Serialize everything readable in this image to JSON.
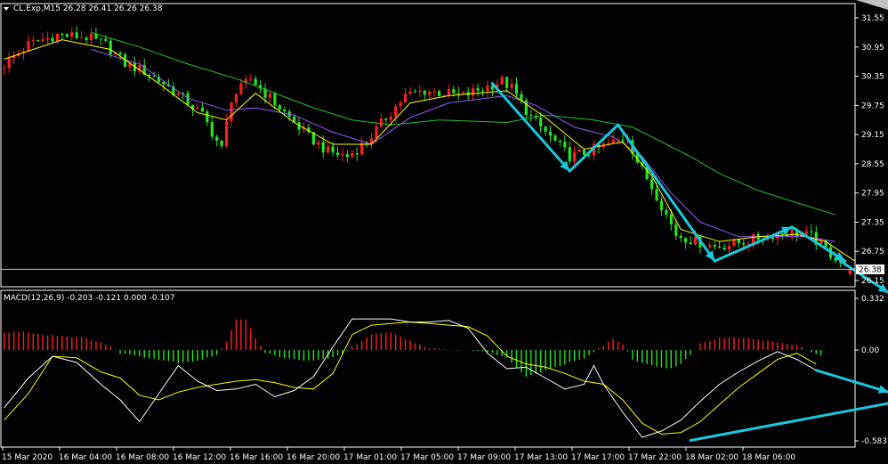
{
  "window": {
    "title": "CL.Exp,M15  26.28 26.41 26.26 26.38",
    "dropdown_icon": "triangle-down-icon",
    "close_icon": "corner-triangle-icon"
  },
  "colors": {
    "background": "#000000",
    "axis": "#ffffff",
    "bull": "#ff1e1e",
    "bear": "#22e622",
    "ma_fast": "#ffff00",
    "ma_mid": "#9b59ff",
    "ma_slow": "#27c427",
    "arrow": "#19c8dc",
    "macd_line": "#ffffff",
    "signal_line": "#ffff00"
  },
  "price_axis": {
    "min": 26.15,
    "max": 31.55,
    "ticks": [
      "31.55",
      "30.95",
      "30.35",
      "29.75",
      "29.15",
      "28.55",
      "27.95",
      "27.35",
      "26.75",
      "26.15"
    ],
    "current_label": "26.38",
    "current_value": 26.38
  },
  "macd_axis": {
    "min": -0.583,
    "max": 0.332,
    "ticks": [
      "0.332",
      "0.00",
      "-0.583"
    ]
  },
  "macd_panel": {
    "title": "MACD(12,26,9) -0.203 -0.121 0.000 -0.107"
  },
  "time_axis": {
    "labels": [
      "15 Mar 2020",
      "16 Mar 04:00",
      "16 Mar 08:00",
      "16 Mar 12:00",
      "16 Mar 16:00",
      "16 Mar 20:00",
      "17 Mar 01:00",
      "17 Mar 05:00",
      "17 Mar 09:00",
      "17 Mar 13:00",
      "17 Mar 17:00",
      "17 Mar 22:00",
      "18 Mar 02:00",
      "18 Mar 06:00"
    ]
  },
  "chart_data": {
    "type": "candlestick",
    "symbol": "CL.Exp",
    "timeframe": "M15",
    "last_bar": {
      "open": 26.28,
      "high": 26.41,
      "low": 26.26,
      "close": 26.38
    },
    "price_path": [
      [
        0,
        30.5
      ],
      [
        6,
        31.0
      ],
      [
        12,
        31.2
      ],
      [
        18,
        31.15
      ],
      [
        22,
        31.0
      ],
      [
        26,
        30.6
      ],
      [
        30,
        30.45
      ],
      [
        34,
        30.2
      ],
      [
        38,
        29.9
      ],
      [
        42,
        29.55
      ],
      [
        46,
        28.85
      ],
      [
        48,
        29.9
      ],
      [
        52,
        30.3
      ],
      [
        56,
        29.9
      ],
      [
        60,
        29.5
      ],
      [
        64,
        29.1
      ],
      [
        68,
        28.8
      ],
      [
        72,
        28.7
      ],
      [
        76,
        29.0
      ],
      [
        80,
        29.5
      ],
      [
        84,
        29.95
      ],
      [
        88,
        30.05
      ],
      [
        92,
        30.0
      ],
      [
        96,
        29.95
      ],
      [
        100,
        30.1
      ],
      [
        104,
        30.25
      ],
      [
        106,
        30.1
      ],
      [
        110,
        29.5
      ],
      [
        114,
        29.1
      ],
      [
        118,
        28.7
      ],
      [
        122,
        28.8
      ],
      [
        126,
        28.95
      ],
      [
        130,
        29.1
      ],
      [
        132,
        28.6
      ],
      [
        136,
        27.9
      ],
      [
        140,
        27.1
      ],
      [
        144,
        26.95
      ],
      [
        148,
        26.85
      ],
      [
        152,
        26.9
      ],
      [
        156,
        27.0
      ],
      [
        160,
        27.1
      ],
      [
        164,
        27.15
      ],
      [
        168,
        27.05
      ],
      [
        172,
        26.7
      ],
      [
        176,
        26.38
      ]
    ],
    "histogram": [
      [
        0,
        0.11
      ],
      [
        4,
        0.12
      ],
      [
        8,
        0.1
      ],
      [
        12,
        0.09
      ],
      [
        16,
        0.08
      ],
      [
        20,
        0.05
      ],
      [
        22,
        0.02
      ],
      [
        24,
        -0.02
      ],
      [
        28,
        -0.04
      ],
      [
        32,
        -0.06
      ],
      [
        36,
        -0.08
      ],
      [
        40,
        -0.07
      ],
      [
        44,
        -0.03
      ],
      [
        46,
        0.05
      ],
      [
        48,
        0.2
      ],
      [
        50,
        0.2
      ],
      [
        52,
        0.08
      ],
      [
        54,
        -0.02
      ],
      [
        58,
        -0.05
      ],
      [
        62,
        -0.07
      ],
      [
        66,
        -0.06
      ],
      [
        70,
        -0.03
      ],
      [
        72,
        0.02
      ],
      [
        76,
        0.1
      ],
      [
        80,
        0.11
      ],
      [
        84,
        0.06
      ],
      [
        88,
        0.01
      ],
      [
        92,
        0.0
      ],
      [
        96,
        0.0
      ],
      [
        100,
        -0.01
      ],
      [
        104,
        -0.05
      ],
      [
        106,
        -0.11
      ],
      [
        108,
        -0.17
      ],
      [
        112,
        -0.13
      ],
      [
        116,
        -0.09
      ],
      [
        120,
        -0.05
      ],
      [
        124,
        0.03
      ],
      [
        126,
        0.07
      ],
      [
        128,
        0.04
      ],
      [
        130,
        -0.06
      ],
      [
        134,
        -0.1
      ],
      [
        138,
        -0.12
      ],
      [
        140,
        -0.09
      ],
      [
        142,
        -0.03
      ],
      [
        144,
        0.04
      ],
      [
        148,
        0.08
      ],
      [
        152,
        0.08
      ],
      [
        156,
        0.07
      ],
      [
        160,
        0.05
      ],
      [
        164,
        0.03
      ],
      [
        168,
        -0.03
      ],
      [
        172,
        -0.05
      ]
    ],
    "macd_line": [
      [
        0,
        -0.37
      ],
      [
        5,
        -0.18
      ],
      [
        10,
        -0.04
      ],
      [
        15,
        -0.08
      ],
      [
        20,
        -0.22
      ],
      [
        24,
        -0.32
      ],
      [
        28,
        -0.46
      ],
      [
        32,
        -0.28
      ],
      [
        36,
        -0.1
      ],
      [
        40,
        -0.2
      ],
      [
        44,
        -0.26
      ],
      [
        48,
        -0.25
      ],
      [
        52,
        -0.22
      ],
      [
        56,
        -0.3
      ],
      [
        60,
        -0.26
      ],
      [
        64,
        -0.17
      ],
      [
        68,
        0.02
      ],
      [
        72,
        0.2
      ],
      [
        76,
        0.2
      ],
      [
        80,
        0.2
      ],
      [
        84,
        0.18
      ],
      [
        88,
        0.18
      ],
      [
        92,
        0.19
      ],
      [
        96,
        0.14
      ],
      [
        100,
        -0.02
      ],
      [
        104,
        -0.12
      ],
      [
        108,
        -0.11
      ],
      [
        112,
        -0.18
      ],
      [
        116,
        -0.25
      ],
      [
        120,
        -0.22
      ],
      [
        122,
        -0.1
      ],
      [
        124,
        -0.22
      ],
      [
        128,
        -0.4
      ],
      [
        132,
        -0.56
      ],
      [
        136,
        -0.52
      ],
      [
        140,
        -0.45
      ],
      [
        144,
        -0.33
      ],
      [
        148,
        -0.22
      ],
      [
        152,
        -0.14
      ],
      [
        156,
        -0.07
      ],
      [
        160,
        -0.01
      ],
      [
        164,
        -0.06
      ],
      [
        168,
        -0.13
      ]
    ],
    "signal_line": [
      [
        0,
        -0.45
      ],
      [
        5,
        -0.28
      ],
      [
        10,
        -0.04
      ],
      [
        15,
        -0.05
      ],
      [
        20,
        -0.14
      ],
      [
        24,
        -0.18
      ],
      [
        28,
        -0.29
      ],
      [
        32,
        -0.32
      ],
      [
        36,
        -0.27
      ],
      [
        40,
        -0.24
      ],
      [
        44,
        -0.22
      ],
      [
        48,
        -0.2
      ],
      [
        52,
        -0.19
      ],
      [
        56,
        -0.21
      ],
      [
        60,
        -0.24
      ],
      [
        64,
        -0.25
      ],
      [
        68,
        -0.15
      ],
      [
        72,
        0.1
      ],
      [
        76,
        0.16
      ],
      [
        80,
        0.17
      ],
      [
        84,
        0.18
      ],
      [
        88,
        0.17
      ],
      [
        92,
        0.16
      ],
      [
        96,
        0.15
      ],
      [
        100,
        0.09
      ],
      [
        104,
        -0.04
      ],
      [
        108,
        -0.09
      ],
      [
        112,
        -0.11
      ],
      [
        116,
        -0.15
      ],
      [
        120,
        -0.2
      ],
      [
        124,
        -0.22
      ],
      [
        128,
        -0.32
      ],
      [
        132,
        -0.47
      ],
      [
        136,
        -0.54
      ],
      [
        140,
        -0.53
      ],
      [
        144,
        -0.46
      ],
      [
        148,
        -0.35
      ],
      [
        152,
        -0.24
      ],
      [
        156,
        -0.15
      ],
      [
        160,
        -0.06
      ],
      [
        164,
        -0.02
      ],
      [
        168,
        -0.09
      ]
    ],
    "ma_fast": [
      [
        0,
        30.7
      ],
      [
        12,
        31.1
      ],
      [
        22,
        30.9
      ],
      [
        32,
        30.2
      ],
      [
        40,
        29.6
      ],
      [
        46,
        29.45
      ],
      [
        52,
        30.0
      ],
      [
        60,
        29.4
      ],
      [
        68,
        28.95
      ],
      [
        76,
        28.95
      ],
      [
        84,
        29.8
      ],
      [
        92,
        29.95
      ],
      [
        104,
        30.05
      ],
      [
        112,
        29.5
      ],
      [
        120,
        28.85
      ],
      [
        128,
        29.0
      ],
      [
        134,
        28.3
      ],
      [
        140,
        27.2
      ],
      [
        148,
        26.95
      ],
      [
        156,
        27.05
      ],
      [
        164,
        27.1
      ],
      [
        170,
        26.95
      ],
      [
        176,
        26.55
      ]
    ],
    "ma_mid": [
      [
        18,
        30.9
      ],
      [
        28,
        30.6
      ],
      [
        38,
        29.9
      ],
      [
        46,
        29.65
      ],
      [
        52,
        29.7
      ],
      [
        60,
        29.55
      ],
      [
        68,
        29.2
      ],
      [
        76,
        28.95
      ],
      [
        84,
        29.5
      ],
      [
        92,
        29.8
      ],
      [
        104,
        29.95
      ],
      [
        110,
        29.75
      ],
      [
        118,
        29.3
      ],
      [
        126,
        29.1
      ],
      [
        132,
        28.7
      ],
      [
        138,
        27.95
      ],
      [
        144,
        27.35
      ],
      [
        152,
        27.05
      ],
      [
        160,
        27.05
      ],
      [
        166,
        27.05
      ],
      [
        172,
        26.95
      ]
    ],
    "ma_slow": [
      [
        18,
        31.25
      ],
      [
        28,
        30.95
      ],
      [
        38,
        30.6
      ],
      [
        48,
        30.3
      ],
      [
        56,
        30.0
      ],
      [
        64,
        29.7
      ],
      [
        72,
        29.45
      ],
      [
        80,
        29.35
      ],
      [
        90,
        29.45
      ],
      [
        104,
        29.4
      ],
      [
        112,
        29.55
      ],
      [
        122,
        29.45
      ],
      [
        130,
        29.3
      ],
      [
        136,
        29.0
      ],
      [
        142,
        28.7
      ],
      [
        148,
        28.35
      ],
      [
        156,
        28.0
      ],
      [
        164,
        27.75
      ],
      [
        172,
        27.5
      ]
    ],
    "price_arrows": [
      [
        [
          101,
          30.2
        ],
        [
          117,
          28.4
        ]
      ],
      [
        [
          117,
          28.4
        ],
        [
          127,
          29.35
        ]
      ],
      [
        [
          127,
          29.35
        ],
        [
          147,
          26.55
        ]
      ],
      [
        [
          147,
          26.55
        ],
        [
          163,
          27.25
        ]
      ],
      [
        [
          163,
          27.25
        ],
        [
          174,
          26.55
        ]
      ]
    ],
    "price_arrows_offchart": [
      [
        [
          173,
          26.55
        ],
        [
          183,
          25.9
        ]
      ],
      [
        [
          183,
          25.9
        ],
        [
          192,
          27.35
        ]
      ]
    ],
    "macd_arrows": [
      [
        [
          168,
          -0.13
        ],
        [
          183,
          -0.27
        ]
      ],
      [
        [
          183,
          -0.27
        ],
        [
          192,
          0.0
        ]
      ],
      [
        [
          142,
          -0.58
        ],
        [
          192,
          -0.29
        ]
      ]
    ]
  }
}
